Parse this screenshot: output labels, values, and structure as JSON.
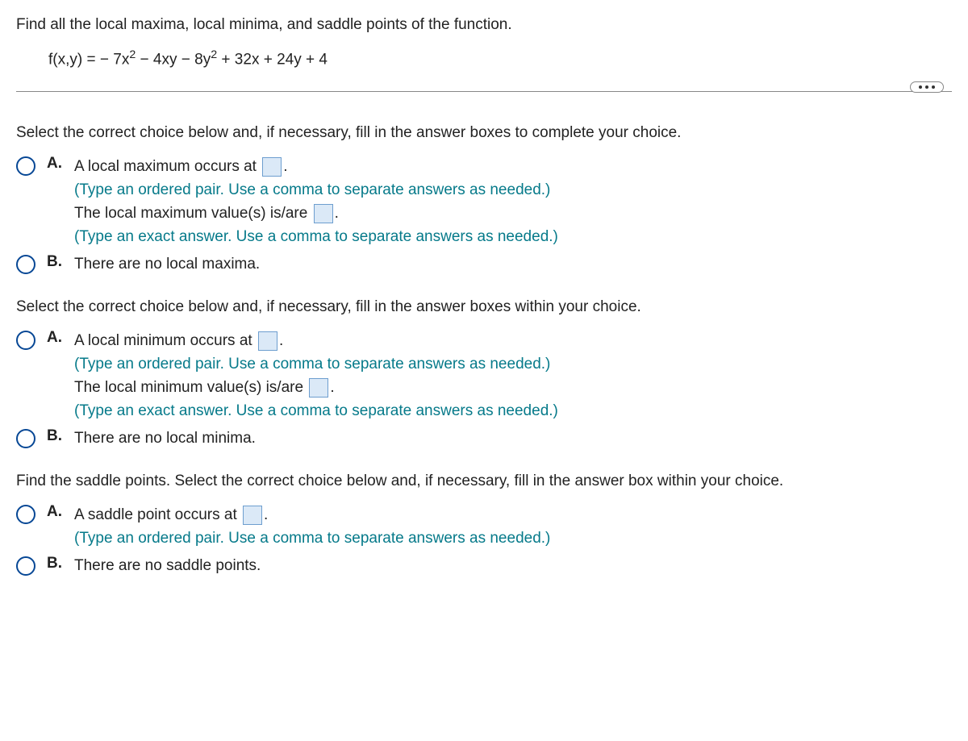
{
  "question_intro": "Find all the local maxima, local minima, and saddle points of the function.",
  "func_lhs": "f(x,y) = ",
  "func_rhs_a": " − 7x",
  "func_rhs_b": " − 4xy − 8y",
  "func_rhs_c": " + 32x + 24y + 4",
  "sup2": "2",
  "sec1": {
    "prompt": "Select the correct choice below and, if necessary, fill in the answer boxes to complete your choice.",
    "A": {
      "l1a": "A local maximum occurs at ",
      "l1b": ".",
      "h1": "(Type an ordered pair. Use a comma to separate answers as needed.)",
      "l2a": "The local maximum value(s) is/are ",
      "l2b": ".",
      "h2": "(Type an exact answer. Use a comma to separate answers as needed.)"
    },
    "B": "There are no local maxima."
  },
  "sec2": {
    "prompt": "Select the correct choice below and, if necessary, fill in the answer boxes within your choice.",
    "A": {
      "l1a": "A local minimum occurs at ",
      "l1b": ".",
      "h1": "(Type an ordered pair. Use a comma to separate answers as needed.)",
      "l2a": "The local minimum value(s) is/are ",
      "l2b": ".",
      "h2": "(Type an exact answer. Use a comma to separate answers as needed.)"
    },
    "B": "There are no local minima."
  },
  "sec3": {
    "prompt": "Find the saddle points. Select the correct choice below and, if necessary, fill in the answer box within your choice.",
    "A": {
      "l1a": "A saddle point occurs at ",
      "l1b": ".",
      "h1": "(Type an ordered pair. Use a comma to separate answers as needed.)"
    },
    "B": "There are no saddle points."
  },
  "labels": {
    "A": "A.",
    "B": "B."
  }
}
